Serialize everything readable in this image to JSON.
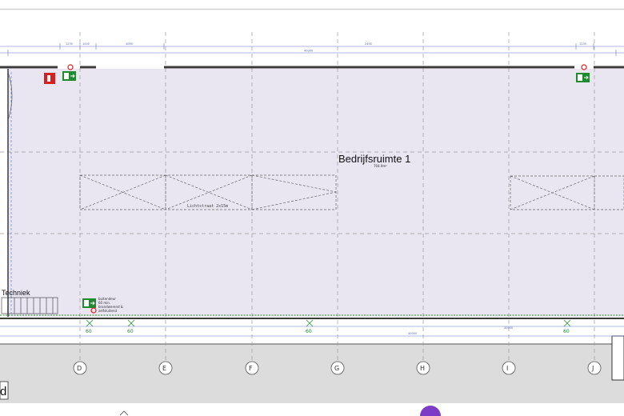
{
  "plan": {
    "room_name": "Bedrijfsruimte 1",
    "room_area": "704.9m²",
    "skylight_label": "Lichtstraat 2x15m",
    "tech_room_label": "Techniek",
    "exit_note": [
      "buitendeur",
      "60 min.",
      "brandwerend &",
      "zelfsluitend"
    ],
    "corner_letter": "d"
  },
  "grid_axes": [
    "D",
    "E",
    "F",
    "G",
    "H",
    "I",
    "J"
  ],
  "door_widths": [
    "60",
    "60",
    "60",
    "60"
  ],
  "dimensions": {
    "top": [
      "1235",
      "1000",
      "4000",
      "2400",
      "40000",
      "1235"
    ],
    "bottom": [
      "40000",
      "40000"
    ]
  },
  "colors": {
    "floor": "#e9e5f1",
    "wall": "#3b3b3b",
    "grid": "#9a9a9a",
    "dimension": "#6677cc",
    "exit_green": "#1f8a2f",
    "fire_red": "#d42020",
    "purple_dot": "#7d3cc8"
  },
  "icons": [
    "fire-extinguisher-icon",
    "emergency-exit-icon",
    "fire-hose-icon",
    "purple-dot-icon"
  ]
}
